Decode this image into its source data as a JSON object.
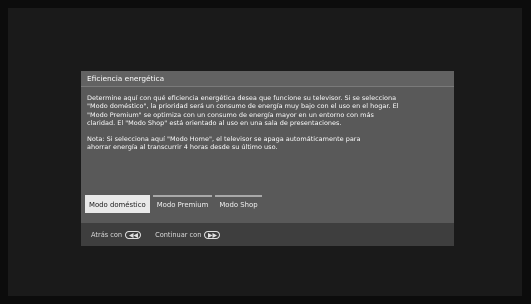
{
  "dialog": {
    "title": "Eficiencia energética",
    "body": "Determine aquí con qué eficiencia energética desea que funcione su televisor. Si se selecciona\n\"Modo doméstico\", la prioridad será un consumo de energía muy bajo con el uso en el hogar. El\n\"Modo Premium\" se optimiza con un consumo de energía mayor en un entorno con más\nclaridad. El \"Modo Shop\" está orientado al uso en una sala de presentaciones.",
    "note": "Nota: Si selecciona aquí \"Modo Home\", el televisor se apaga automáticamente para\nahorrar energía al transcurrir 4 horas desde su último uso.",
    "options": [
      {
        "label": "Modo doméstico",
        "selected": true
      },
      {
        "label": "Modo Premium",
        "selected": false
      },
      {
        "label": "Modo Shop",
        "selected": false
      }
    ]
  },
  "footer": {
    "back_label": "Atrás con",
    "back_icon": "rewind-key-icon",
    "continue_label": "Continuar con",
    "continue_icon": "forward-key-icon"
  }
}
